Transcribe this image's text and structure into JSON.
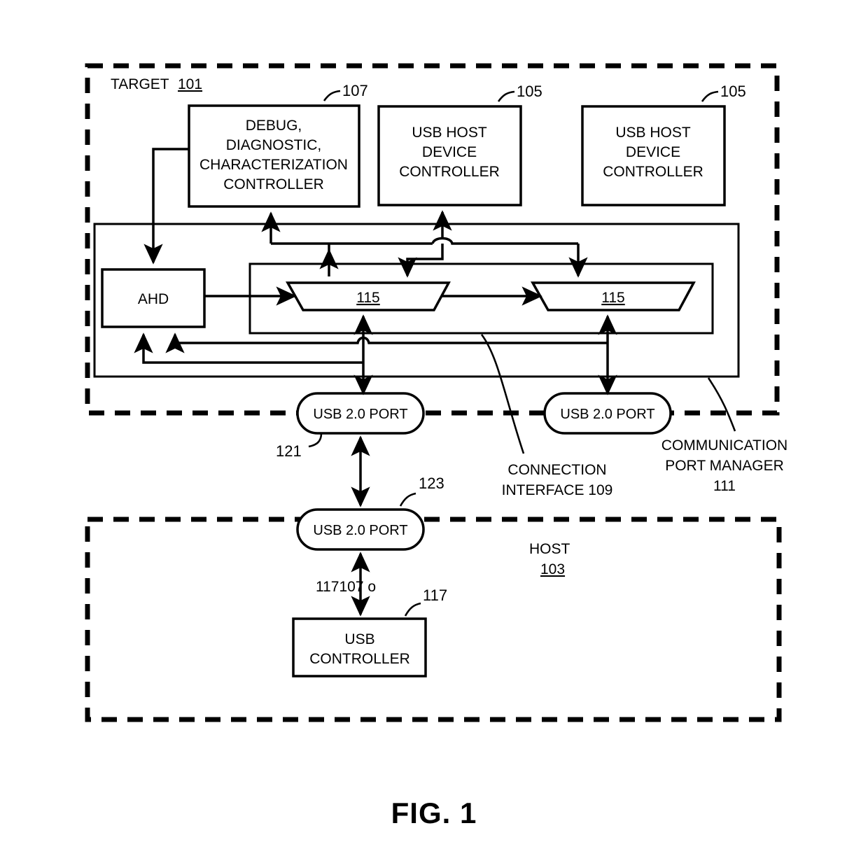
{
  "figure": {
    "caption": "FIG. 1"
  },
  "target": {
    "label": "TARGET",
    "ref": "101"
  },
  "host": {
    "label": "HOST",
    "ref": "103"
  },
  "blocks": {
    "debug_controller": {
      "lines": [
        "DEBUG,",
        "DIAGNOSTIC,",
        "CHARACTERIZATION",
        "CONTROLLER"
      ],
      "ref": "107"
    },
    "usb_host_device_controller_1": {
      "lines": [
        "USB HOST",
        "DEVICE",
        "CONTROLLER"
      ],
      "ref": "105"
    },
    "usb_host_device_controller_2": {
      "lines": [
        "USB HOST",
        "DEVICE",
        "CONTROLLER"
      ],
      "ref": "105"
    },
    "ahd": {
      "label": "AHD"
    },
    "mux_1": {
      "ref": "115"
    },
    "mux_2": {
      "ref": "115"
    },
    "usb_controller": {
      "lines": [
        "USB",
        "CONTROLLER"
      ],
      "ref": "117"
    }
  },
  "ports": {
    "target_port_1": {
      "label": "USB 2.0 PORT",
      "ref": "121"
    },
    "target_port_2": {
      "label": "USB 2.0 PORT"
    },
    "host_port": {
      "label": "USB 2.0 PORT",
      "ref": "123"
    }
  },
  "annotations": {
    "connection_interface": {
      "lines": [
        "CONNECTION",
        "INTERFACE 109"
      ]
    },
    "communication_port_manager": {
      "lines": [
        "COMMUNICATION",
        "PORT MANAGER",
        "111"
      ]
    },
    "link_label": "117107 o"
  },
  "colors": {
    "line": "#000000",
    "background": "#ffffff"
  }
}
